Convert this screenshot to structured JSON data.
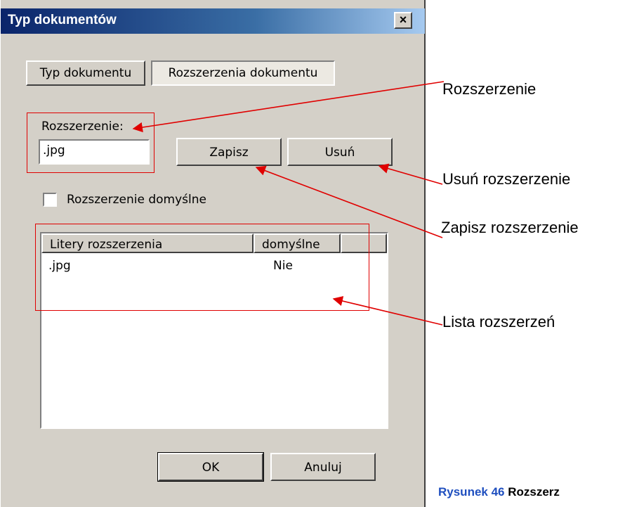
{
  "dialog": {
    "title": "Typ dokumentów",
    "close_glyph": "×",
    "tabs": [
      {
        "label": "Typ dokumentu",
        "active": false
      },
      {
        "label": "Rozszerzenia dokumentu",
        "active": true
      }
    ],
    "extension_label": "Rozszerzenie:",
    "extension_value": ".jpg",
    "save_label": "Zapisz",
    "delete_label": "Usuń",
    "default_checkbox_label": "Rozszerzenie domyślne",
    "default_checked": false,
    "list": {
      "columns": [
        "Litery rozszerzenia",
        "domyślne"
      ],
      "rows": [
        {
          "ext": ".jpg",
          "default": "Nie"
        }
      ]
    },
    "ok_label": "OK",
    "cancel_label": "Anuluj"
  },
  "annotations": {
    "extension": "Rozszerzenie",
    "delete": "Usuń rozszerzenie",
    "save": "Zapisz rozszerzenie",
    "list": "Lista rozszerzeń"
  },
  "caption": {
    "number": "Rysunek 46",
    "text": "Rozszerz"
  },
  "colors": {
    "annotation_line": "#e00000",
    "caption_number": "#1f4fbf",
    "title_bar": "#0a246a"
  }
}
